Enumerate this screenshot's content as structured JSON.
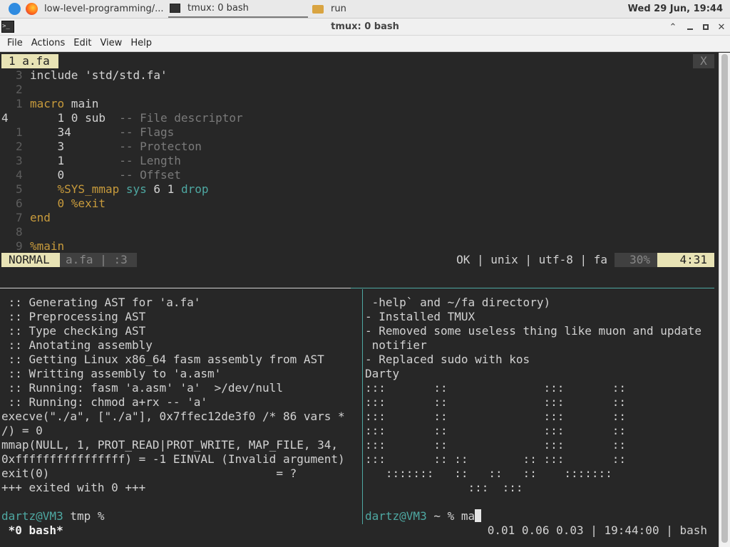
{
  "panel": {
    "tasks": [
      {
        "label": "low-level-programming/...",
        "icon": "firefox-icon"
      },
      {
        "label": "tmux: 0 bash",
        "icon": "terminal-icon"
      },
      {
        "label": "run",
        "icon": "folder-icon"
      }
    ],
    "clock": "Wed 29 Jun, 19:44"
  },
  "window": {
    "title": "tmux: 0 bash",
    "menus": [
      "File",
      "Actions",
      "Edit",
      "View",
      "Help"
    ]
  },
  "editor": {
    "tab": "1 a.fa",
    "close": "X",
    "status": {
      "mode": "NORMAL",
      "file": "a.fa",
      "sep": "|",
      "line": ":3",
      "right": "OK | unix | utf-8 | fa",
      "percent": "30%",
      "position": "4:31"
    },
    "lines": [
      {
        "ln": "3",
        "t1": "include ",
        "t2": "'std/std.fa'"
      },
      {
        "ln": "2",
        "t1": ""
      },
      {
        "ln": "1",
        "t1": "macro",
        "t2": " main"
      },
      {
        "ln": "4",
        "t1": "    1 0 sub  ",
        "c": "-- File descriptor"
      },
      {
        "ln": "1",
        "t1": "    34       ",
        "c": "-- Flags"
      },
      {
        "ln": "2",
        "t1": "    3        ",
        "c": "-- Protecton"
      },
      {
        "ln": "3",
        "t1": "    1        ",
        "c": "-- Length"
      },
      {
        "ln": "4",
        "t1": "    0        ",
        "c": "-- Offset"
      },
      {
        "ln": "5",
        "t1": "    %SYS_mmap ",
        "k": "sys",
        "t3": " 6 1 ",
        "k2": "drop"
      },
      {
        "ln": "6",
        "t1": "    0 %exit"
      },
      {
        "ln": "7",
        "t1": "end"
      },
      {
        "ln": "8",
        "t1": ""
      },
      {
        "ln": "9",
        "t1": "%main"
      }
    ]
  },
  "left_pane": {
    "lines": [
      " :: Generating AST for 'a.fa'",
      " :: Preprocessing AST",
      " :: Type checking AST",
      " :: Anotating assembly",
      " :: Getting Linux x86_64 fasm assembly from AST",
      " :: Writting assembly to 'a.asm'",
      " :: Running: fasm 'a.asm' 'a'  >/dev/null",
      " :: Running: chmod a+rx -- 'a'",
      "execve(\"./a\", [\"./a\"], 0x7ffec12de3f0 /* 86 vars *",
      "/) = 0",
      "mmap(NULL, 1, PROT_READ|PROT_WRITE, MAP_FILE, 34,",
      "0xffffffffffffffff) = -1 EINVAL (Invalid argument)",
      "exit(0)                                 = ?",
      "+++ exited with 0 +++",
      ""
    ],
    "prompt_user": "dartz@VM3",
    "prompt_rest": " tmp %"
  },
  "right_pane": {
    "lines": [
      " -help` and ~/fa directory)",
      "- Installed TMUX",
      "- Removed some useless thing like muon and update",
      " notifier",
      "- Replaced sudo with kos",
      "Darty",
      ":::       ::              :::       ::",
      ":::       ::              :::       ::",
      ":::       ::              :::       ::",
      ":::       ::              :::       ::",
      ":::       ::              :::       ::",
      ":::       :: ::        :: :::       ::",
      "   :::::::   ::   ::   ::    :::::::",
      "               :::  :::",
      ""
    ],
    "prompt_user": "dartz@VM3",
    "prompt_rest": " ~ % ma"
  },
  "tmux_status": {
    "window": " *0 bash*",
    "right": "0.01 0.06 0.03 | 19:44:00 | bash"
  }
}
